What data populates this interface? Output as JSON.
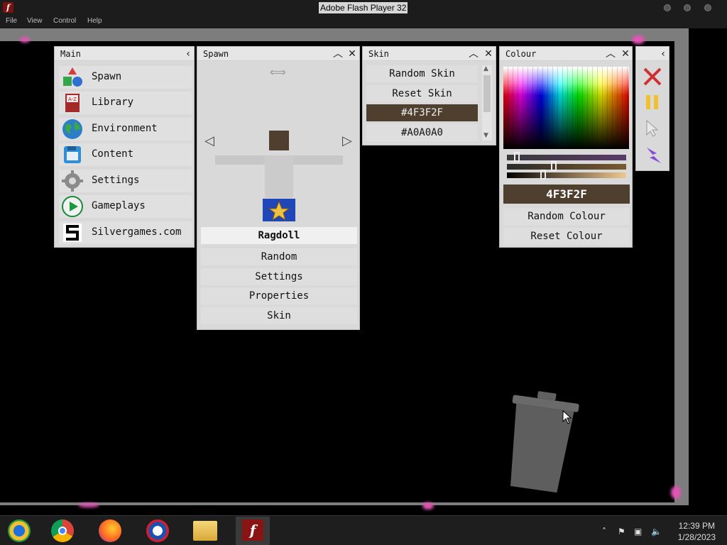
{
  "window": {
    "title": "Adobe Flash Player 32"
  },
  "menubar": {
    "items": [
      "File",
      "View",
      "Control",
      "Help"
    ]
  },
  "main_panel": {
    "title": "Main",
    "items": [
      {
        "label": "Spawn",
        "icon": "shapes-icon"
      },
      {
        "label": "Library",
        "icon": "book-icon"
      },
      {
        "label": "Environment",
        "icon": "globe-icon"
      },
      {
        "label": "Content",
        "icon": "floppy-icon"
      },
      {
        "label": "Settings",
        "icon": "gear-icon"
      },
      {
        "label": "Gameplays",
        "icon": "play-icon"
      },
      {
        "label": "Silvergames.com",
        "icon": "silvergames-logo-icon"
      }
    ]
  },
  "spawn_panel": {
    "title": "Spawn",
    "selected": "Ragdoll",
    "buttons": [
      "Random",
      "Settings",
      "Properties",
      "Skin"
    ]
  },
  "skin_panel": {
    "title": "Skin",
    "items": [
      "Random Skin",
      "Reset Skin",
      "#4F3F2F",
      "#A0A0A0"
    ],
    "selected_index": 2
  },
  "colour_panel": {
    "title": "Colour",
    "hex_value": "4F3F2F",
    "buttons": [
      "Random Colour",
      "Reset Colour"
    ]
  },
  "colors": {
    "selected_skin": "#4F3F2F",
    "panel_bg": "#D9D9D9",
    "stage_border": "#7D7D7D"
  },
  "taskbar": {
    "time": "12:39 PM",
    "date": "1/28/2023"
  }
}
